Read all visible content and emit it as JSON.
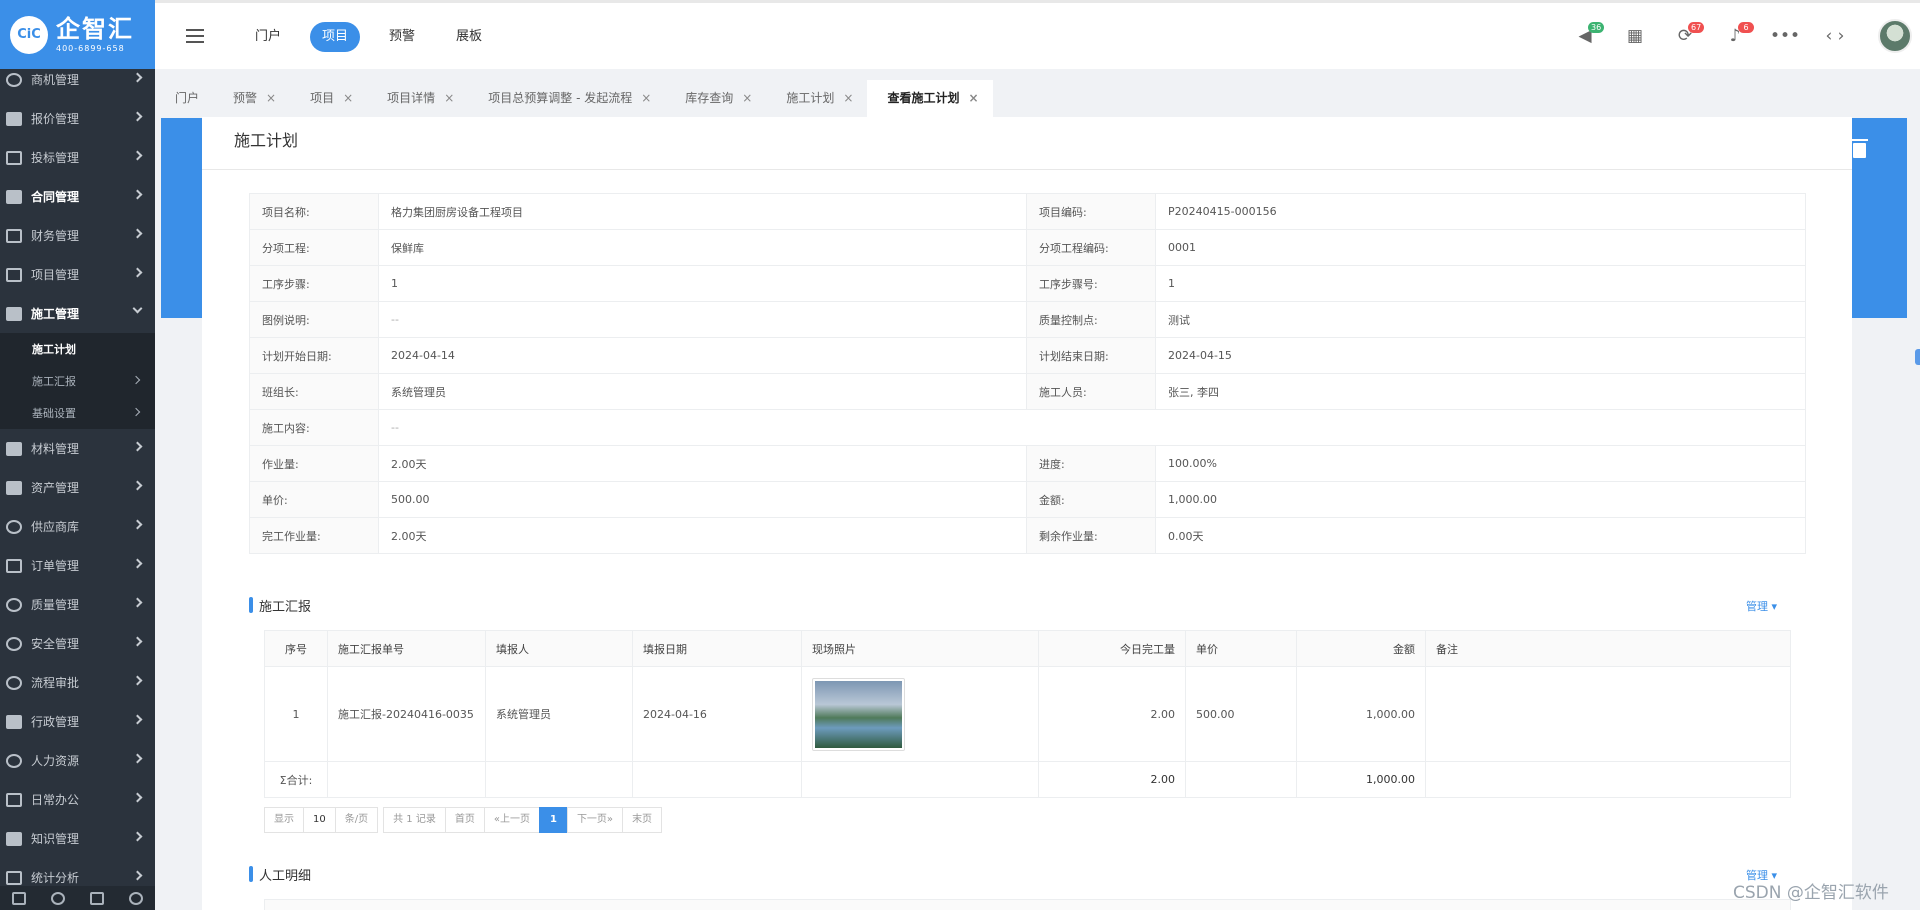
{
  "brand": {
    "name": "企智汇",
    "phone": "400-6899-658",
    "mark": "CiC"
  },
  "sidebar": {
    "items": [
      {
        "label": "商机管理",
        "icon": "cloud-icon"
      },
      {
        "label": "报价管理",
        "icon": "clipboard-icon"
      },
      {
        "label": "投标管理",
        "icon": "flag-icon"
      },
      {
        "label": "合同管理",
        "icon": "book-icon"
      },
      {
        "label": "财务管理",
        "icon": "money-icon"
      },
      {
        "label": "项目管理",
        "icon": "layout-icon"
      },
      {
        "label": "施工管理",
        "icon": "hammer-icon"
      },
      {
        "label": "材料管理",
        "icon": "folder-icon"
      },
      {
        "label": "资产管理",
        "icon": "printer-icon"
      },
      {
        "label": "供应商库",
        "icon": "globe-icon"
      },
      {
        "label": "订单管理",
        "icon": "list-icon"
      },
      {
        "label": "质量管理",
        "icon": "gauge-icon"
      },
      {
        "label": "安全管理",
        "icon": "shield-icon"
      },
      {
        "label": "流程审批",
        "icon": "refresh-icon"
      },
      {
        "label": "行政管理",
        "icon": "briefcase-icon"
      },
      {
        "label": "人力资源",
        "icon": "user-icon"
      },
      {
        "label": "日常办公",
        "icon": "edit-icon"
      },
      {
        "label": "知识管理",
        "icon": "book-open-icon"
      },
      {
        "label": "统计分析",
        "icon": "chart-icon"
      }
    ],
    "sub": [
      "施工计划",
      "施工汇报",
      "基础设置"
    ]
  },
  "topnav": [
    "门户",
    "项目",
    "预警",
    "展板"
  ],
  "badges": {
    "announce": "36",
    "sync": "67",
    "bell": "6"
  },
  "tabs": [
    {
      "label": "门户"
    },
    {
      "label": "预警"
    },
    {
      "label": "项目"
    },
    {
      "label": "项目详情"
    },
    {
      "label": "项目总预算调整 - 发起流程"
    },
    {
      "label": "库存查询"
    },
    {
      "label": "施工计划"
    },
    {
      "label": "查看施工计划"
    }
  ],
  "page": {
    "title": "施工计划"
  },
  "info": {
    "project_name_label": "项目名称:",
    "project_name": "格力集团厨房设备工程项目",
    "project_code_label": "项目编码:",
    "project_code": "P20240415-000156",
    "sub_project_label": "分项工程:",
    "sub_project": "保鲜库",
    "sub_code_label": "分项工程编码:",
    "sub_code": "0001",
    "step_label": "工序步骤:",
    "step": "1",
    "step_no_label": "工序步骤号:",
    "step_no": "1",
    "legend_label": "图例说明:",
    "legend": "--",
    "qc_label": "质量控制点:",
    "qc": "测试",
    "start_label": "计划开始日期:",
    "start": "2024-04-14",
    "end_label": "计划结束日期:",
    "end": "2024-04-15",
    "leader_label": "班组长:",
    "leader": "系统管理员",
    "workers_label": "施工人员:",
    "workers": "张三, 李四",
    "content_label": "施工内容:",
    "content": "--",
    "workload_label": "作业量:",
    "workload": "2.00天",
    "progress_label": "进度:",
    "progress": "100.00%",
    "price_label": "单价:",
    "price": "500.00",
    "amount_label": "金额:",
    "amount": "1,000.00",
    "done_label": "完工作业量:",
    "done": "2.00天",
    "remain_label": "剩余作业量:",
    "remain": "0.00天"
  },
  "report": {
    "title": "施工汇报",
    "manage": "管理",
    "headers": [
      "序号",
      "施工汇报单号",
      "填报人",
      "填报日期",
      "现场照片",
      "今日完工量",
      "单价",
      "金额",
      "备注"
    ],
    "row": {
      "no": "1",
      "code": "施工汇报-20240416-0035",
      "reporter": "系统管理员",
      "date": "2024-04-16",
      "qty": "2.00",
      "price": "500.00",
      "amount": "1,000.00",
      "remark": ""
    },
    "total": {
      "label": "Σ合计:",
      "qty": "2.00",
      "amount": "1,000.00"
    }
  },
  "pager": {
    "show": "显示",
    "size": "10",
    "per": "条/页",
    "total": "共 1 记录",
    "first": "首页",
    "prev": "«上一页",
    "current": "1",
    "next": "下一页»",
    "last": "末页"
  },
  "labor": {
    "title": "人工明细",
    "manage": "管理"
  },
  "watermark": "CSDN @企智汇软件"
}
